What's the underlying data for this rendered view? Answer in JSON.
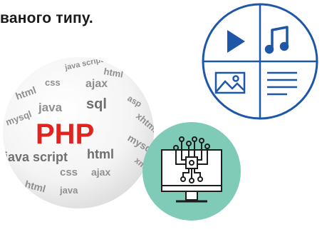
{
  "headline": {
    "text": "ваного типу."
  },
  "sphere_words": {
    "center": "PHP",
    "words": [
      "java script",
      "html",
      "css",
      "ajax",
      "html",
      "java",
      "sql",
      "asp",
      "xhtml",
      "mysql",
      "mysql",
      "java script",
      "html",
      "css",
      "ajax",
      "xml",
      "java",
      "html"
    ]
  },
  "icons": {
    "media": [
      "play-icon",
      "music-note-icon",
      "image-icon",
      "text-lines-icon"
    ],
    "computer": "computer-chip-icon"
  },
  "colors": {
    "php_red": "#e3231e",
    "media_blue": "#1f57a8",
    "computer_teal": "#7fcbb8",
    "computer_outline": "#1d1d1d"
  }
}
